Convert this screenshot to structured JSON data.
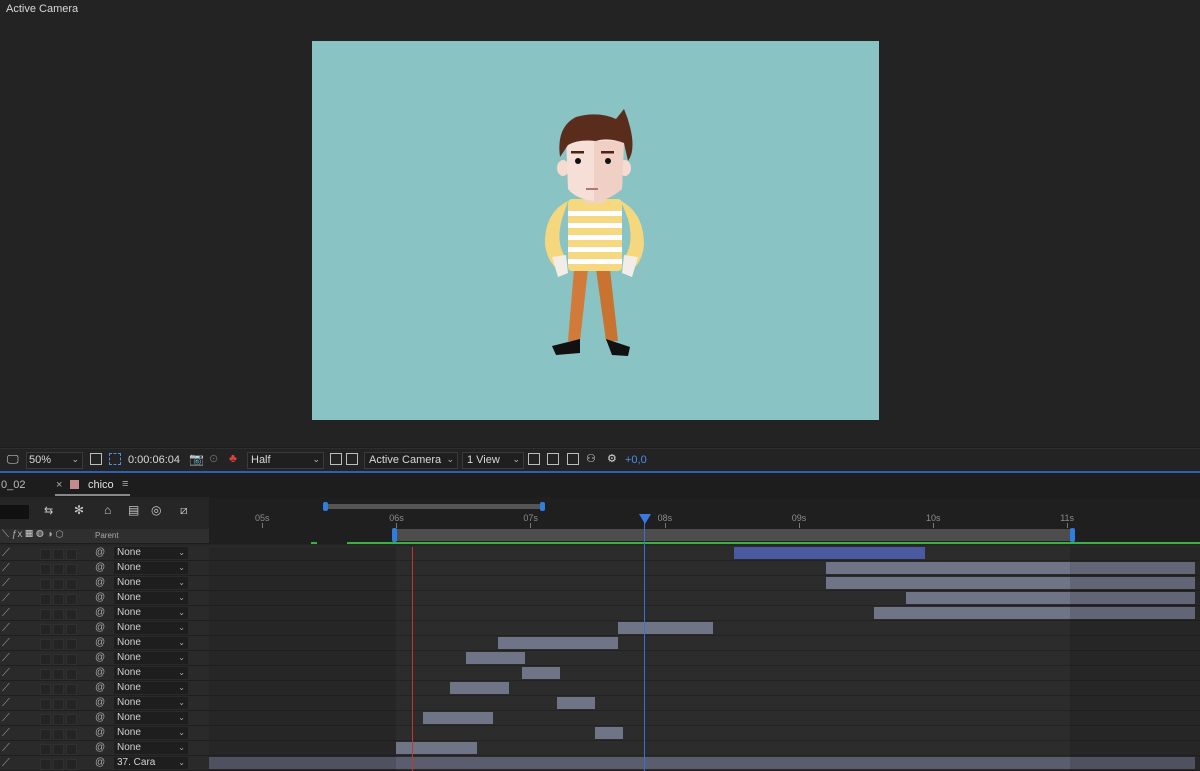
{
  "viewer": {
    "panel_label": "Active Camera",
    "background_color": "#8ac3c4"
  },
  "viewer_toolbar": {
    "zoom": "50%",
    "timecode": "0:00:06:04",
    "resolution": "Half",
    "camera": "Active Camera",
    "views": "1 View",
    "exposure": "+0,0"
  },
  "timeline": {
    "tabs": [
      {
        "label": "0_02"
      },
      {
        "label": "chico",
        "active": true
      }
    ],
    "close_glyph": "×",
    "menu_glyph": "≡",
    "column_header": "Parent",
    "ruler_ticks": [
      "05s",
      "06s",
      "07s",
      "08s",
      "09s",
      "10s",
      "11s"
    ],
    "current_time": "6.2",
    "work_area": [
      "6.0",
      "11.0"
    ],
    "layers": [
      {
        "parent": "None",
        "bar_start": 8.52,
        "bar_end": 9.94,
        "selected": true
      },
      {
        "parent": "None",
        "bar_start": 9.2,
        "bar_end": 11.95
      },
      {
        "parent": "None",
        "bar_start": 9.2,
        "bar_end": 11.95
      },
      {
        "parent": "None",
        "bar_start": 9.8,
        "bar_end": 11.95
      },
      {
        "parent": "None",
        "bar_start": 9.56,
        "bar_end": 11.95
      },
      {
        "parent": "None",
        "bar_start": 7.65,
        "bar_end": 8.36
      },
      {
        "parent": "None",
        "bar_start": 6.76,
        "bar_end": 7.65
      },
      {
        "parent": "None",
        "bar_start": 6.52,
        "bar_end": 6.96
      },
      {
        "parent": "None",
        "bar_start": 6.94,
        "bar_end": 7.22
      },
      {
        "parent": "None",
        "bar_start": 6.4,
        "bar_end": 6.84
      },
      {
        "parent": "None",
        "bar_start": 7.2,
        "bar_end": 7.48
      },
      {
        "parent": "None",
        "bar_start": 6.2,
        "bar_end": 6.72
      },
      {
        "parent": "None",
        "bar_start": 7.48,
        "bar_end": 7.69
      },
      {
        "parent": "None",
        "bar_start": 6.0,
        "bar_end": 6.6
      },
      {
        "parent": "37. Cara",
        "bar_start": 4.6,
        "bar_end": 11.95
      }
    ]
  },
  "colors": {
    "accent_blue": "#2d7ee0",
    "playhead": "#3a6fd8",
    "in_marker": "#c0392b",
    "layer_bar": "#6f7487",
    "selected_bar": "#4a5aa0",
    "green_line": "#3cb043"
  }
}
